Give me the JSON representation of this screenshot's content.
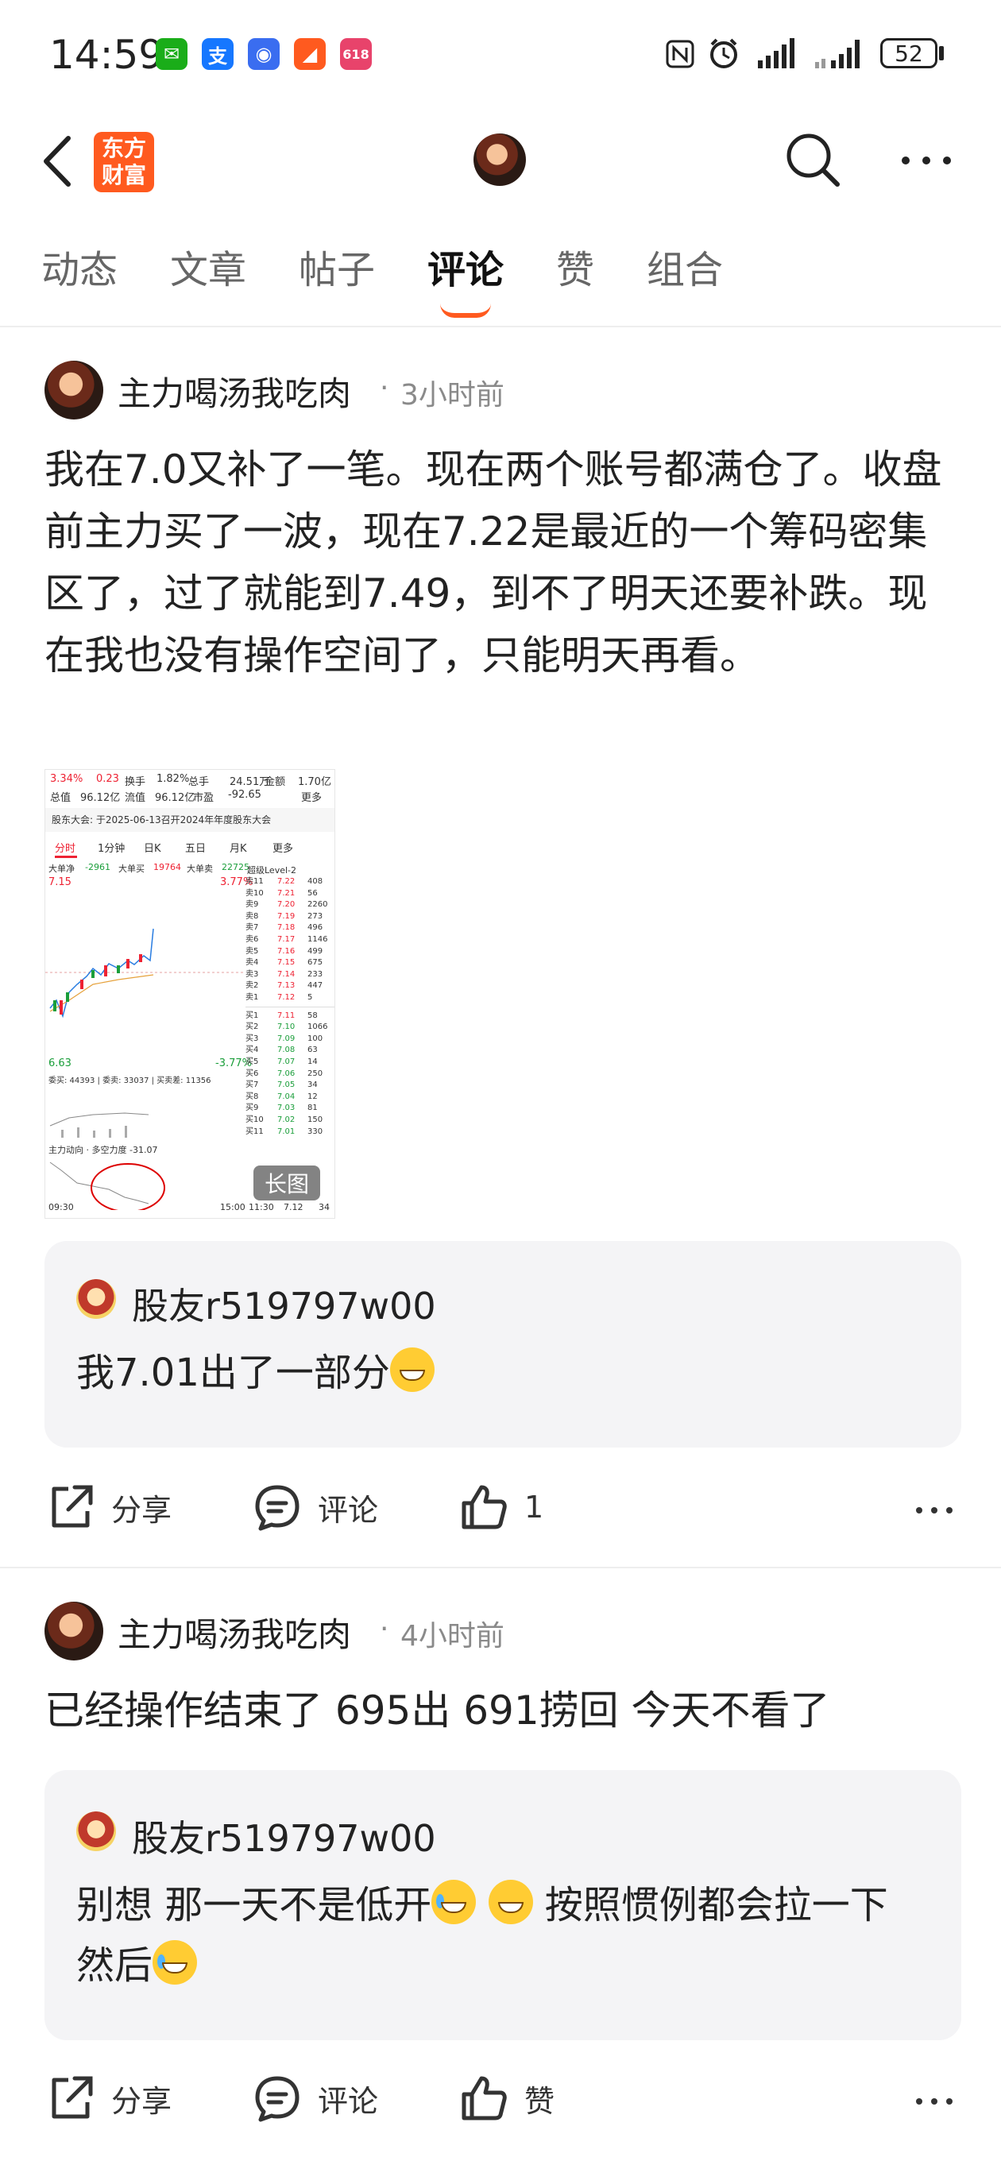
{
  "status_bar": {
    "time": "14:59",
    "battery": "52",
    "apps": [
      {
        "icon": "wechat-icon",
        "color": "#1aad19",
        "glyph": "✉"
      },
      {
        "icon": "alipay-icon",
        "color": "#1677ff",
        "glyph": "支"
      },
      {
        "icon": "app-icon-blue",
        "color": "#3a6df0",
        "glyph": "◉"
      },
      {
        "icon": "app-icon-orange",
        "color": "#ff5a1f",
        "glyph": "◢"
      },
      {
        "icon": "shopping-618-icon",
        "color": "#e8436b",
        "glyph": "618"
      }
    ]
  },
  "header": {
    "brand": "东方财富",
    "back_icon": "back-arrow-icon",
    "search_icon": "search-icon",
    "more_icon": "more-icon"
  },
  "tabs": [
    "动态",
    "文章",
    "帖子",
    "评论",
    "赞",
    "组合"
  ],
  "active_tab": "评论",
  "posts": [
    {
      "author": "主力喝汤我吃肉",
      "time": "3小时前",
      "text": "我在7.0又补了一笔。现在两个账号都满仓了。收盘前主力买了一波，现在7.22是最近的一个筹码密集区了，过了就能到7.49，到不了明天还要补跌。现在我也没有操作空间了，只能明天再看。",
      "image_badge": "长图",
      "reply": {
        "user": "股友r519797w00",
        "text": "我7.01出了一部分"
      },
      "actions": {
        "share": "分享",
        "comment": "评论",
        "like": "1"
      }
    },
    {
      "author": "主力喝汤我吃肉",
      "time": "4小时前",
      "text": "已经操作结束了 695出 691捞回 今天不看了",
      "reply": {
        "user": "股友r519797w00",
        "text_a": "别想 那一天不是低开",
        "text_b": "按照惯例都会拉一下 然后"
      },
      "actions": {
        "share": "分享",
        "comment": "评论",
        "like": "赞"
      }
    }
  ],
  "chart_image": {
    "row1": [
      "3.34%",
      "0.23",
      "换手",
      "1.82%",
      "总手",
      "24.51万",
      "金额",
      "1.70亿"
    ],
    "row2": [
      "总值",
      "96.12亿",
      "流值",
      "96.12亿",
      "市盈",
      "-92.65",
      "更多"
    ],
    "notice": "股东大会: 于2025-06-13召开2024年年度股东大会",
    "period_tabs": [
      "分时",
      "1分钟",
      "日K",
      "五日",
      "月K",
      "更多"
    ],
    "flow": [
      "大单净",
      "-2961",
      "大单买",
      "19764",
      "大单卖",
      "22725"
    ],
    "price_high": "7.15",
    "pct_high": "3.77%",
    "price_low": "6.63",
    "pct_low": "-3.77%",
    "level_title": "超级Level-2",
    "asks": [
      [
        "卖11",
        "7.22",
        "408"
      ],
      [
        "卖10",
        "7.21",
        "56"
      ],
      [
        "卖9",
        "7.20",
        "2260"
      ],
      [
        "卖8",
        "7.19",
        "273"
      ],
      [
        "卖7",
        "7.18",
        "496"
      ],
      [
        "卖6",
        "7.17",
        "1146"
      ],
      [
        "卖5",
        "7.16",
        "499"
      ],
      [
        "卖4",
        "7.15",
        "675"
      ],
      [
        "卖3",
        "7.14",
        "233"
      ],
      [
        "卖2",
        "7.13",
        "447"
      ],
      [
        "卖1",
        "7.12",
        "5"
      ]
    ],
    "bids": [
      [
        "买1",
        "7.11",
        "58"
      ],
      [
        "买2",
        "7.10",
        "1066"
      ],
      [
        "买3",
        "7.09",
        "100"
      ],
      [
        "买4",
        "7.08",
        "63"
      ],
      [
        "买5",
        "7.07",
        "14"
      ],
      [
        "买6",
        "7.06",
        "250"
      ],
      [
        "买7",
        "7.05",
        "34"
      ],
      [
        "买8",
        "7.04",
        "12"
      ],
      [
        "买9",
        "7.03",
        "81"
      ],
      [
        "买10",
        "7.02",
        "150"
      ],
      [
        "买11",
        "7.01",
        "330"
      ]
    ],
    "volume_label": "委买: 44393 | 委卖: 33037 | 买卖差: 11356",
    "indicator": "主力动向 · 多空力度 -31.07",
    "time_start": "09:30",
    "time_end": "15:00",
    "trade_time": "11:30",
    "trade_price": "7.12",
    "trade_vol": "34"
  }
}
